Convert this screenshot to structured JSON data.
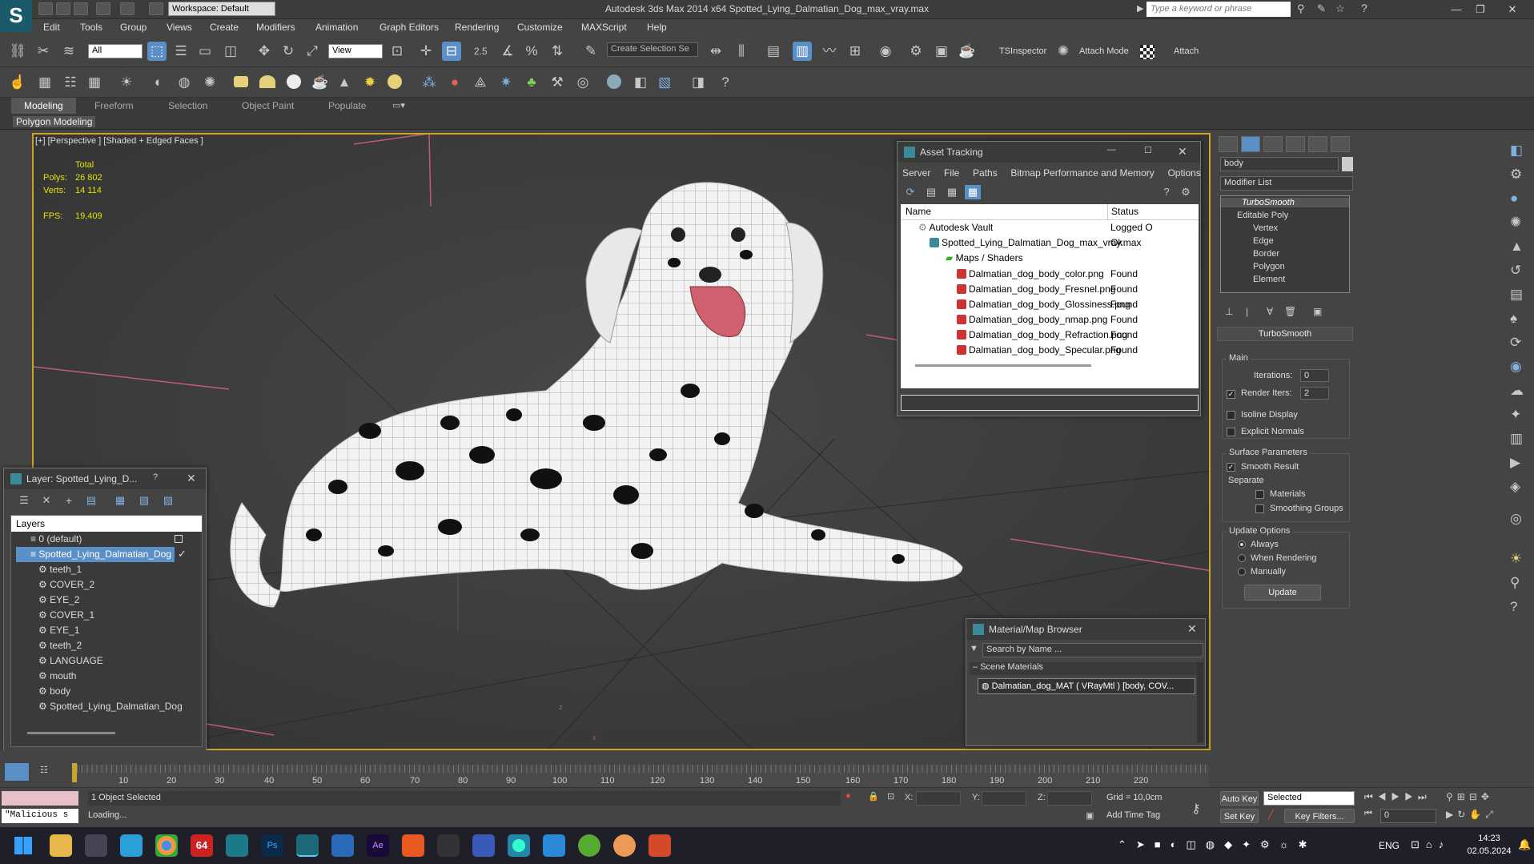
{
  "window": {
    "title": "Autodesk 3ds Max  2014 x64     Spotted_Lying_Dalmatian_Dog_max_vray.max",
    "workspace": "Workspace: Default",
    "search_placeholder": "Type a keyword or phrase"
  },
  "menu": [
    "Edit",
    "Tools",
    "Group",
    "Views",
    "Create",
    "Modifiers",
    "Animation",
    "Graph Editors",
    "Rendering",
    "Customize",
    "MAXScript",
    "Help"
  ],
  "toolbar": {
    "selection_filter": "All",
    "ref_coord": "View",
    "angle_snap": "2.5",
    "selection_set": "Create Selection Se",
    "tsinspector": "TSInspector",
    "attach_mode": "Attach Mode",
    "attach": "Attach"
  },
  "ribbon": {
    "tabs": [
      "Modeling",
      "Freeform",
      "Selection",
      "Object Paint",
      "Populate"
    ],
    "panel_label": "Polygon Modeling"
  },
  "viewport": {
    "label": "[+] [Perspective ] [Shaded + Edged Faces ]",
    "stats_header": "Total",
    "polys_label": "Polys:",
    "polys_value": "26 802",
    "verts_label": "Verts:",
    "verts_value": "14 114",
    "fps_label": "FPS:",
    "fps_value": "19,409",
    "axis_z": "z",
    "axis_x": "x"
  },
  "asset_tracking": {
    "title": "Asset Tracking",
    "menu": [
      "Server",
      "File",
      "Paths",
      "Bitmap Performance and Memory",
      "Options"
    ],
    "col_name": "Name",
    "col_status": "Status",
    "rows": [
      {
        "name": "Autodesk Vault",
        "status": "Logged O"
      },
      {
        "name": "Spotted_Lying_Dalmatian_Dog_max_vray.max",
        "status": "Ok"
      },
      {
        "name": "Maps / Shaders",
        "status": ""
      },
      {
        "name": "Dalmatian_dog_body_color.png",
        "status": "Found"
      },
      {
        "name": "Dalmatian_dog_body_Fresnel.png",
        "status": "Found"
      },
      {
        "name": "Dalmatian_dog_body_Glossiness.png",
        "status": "Found"
      },
      {
        "name": "Dalmatian_dog_body_nmap.png",
        "status": "Found"
      },
      {
        "name": "Dalmatian_dog_body_Refraction.png",
        "status": "Found"
      },
      {
        "name": "Dalmatian_dog_body_Specular.png",
        "status": "Found"
      }
    ]
  },
  "layer_explorer": {
    "title": "Layer: Spotted_Lying_D...",
    "help": "?",
    "header": "Layers",
    "layers": [
      "0 (default)",
      "Spotted_Lying_Dalmatian_Dog"
    ],
    "objects": [
      "teeth_1",
      "COVER_2",
      "EYE_2",
      "COVER_1",
      "EYE_1",
      "teeth_2",
      "LANGUAGE",
      "mouth",
      "body",
      "Spotted_Lying_Dalmatian_Dog"
    ]
  },
  "material_browser": {
    "title": "Material/Map Browser",
    "search_placeholder": "Search by Name ...",
    "section": "Scene Materials",
    "item": "Dalmatian_dog_MAT ( VRayMtl ) [body, COV..."
  },
  "command_panel": {
    "object_name": "body",
    "modifier_list": "Modifier List",
    "stack": [
      "TurboSmooth",
      "Editable Poly",
      "Vertex",
      "Edge",
      "Border",
      "Polygon",
      "Element"
    ],
    "rollout_title": "TurboSmooth",
    "main_label": "Main",
    "iterations_label": "Iterations:",
    "iterations_value": "0",
    "render_iters_label": "Render Iters:",
    "render_iters_value": "2",
    "isoline": "Isoline Display",
    "explicit_normals": "Explicit Normals",
    "surface_params": "Surface Parameters",
    "smooth_result": "Smooth Result",
    "separate": "Separate",
    "materials": "Materials",
    "smoothing_groups": "Smoothing Groups",
    "update_options": "Update Options",
    "always": "Always",
    "when_rendering": "When Rendering",
    "manually": "Manually",
    "update_button": "Update"
  },
  "timeline": {
    "ticks": [
      "10",
      "20",
      "30",
      "40",
      "50",
      "60",
      "70",
      "80",
      "90",
      "100",
      "110",
      "120",
      "130",
      "140",
      "150",
      "160",
      "170",
      "180",
      "190",
      "200",
      "210",
      "220"
    ]
  },
  "status": {
    "maxscript": "\"Malicious s",
    "selected": "1 Object Selected",
    "loading": "Loading...",
    "x_label": "X:",
    "y_label": "Y:",
    "z_label": "Z:",
    "grid": "Grid = 10,0cm",
    "add_time_tag": "Add Time Tag",
    "auto_key": "Auto Key",
    "set_key": "Set Key",
    "key_mode": "Selected",
    "key_filters": "Key Filters...",
    "frame": "0"
  },
  "taskbar": {
    "badge": "64",
    "lang": "ENG",
    "time": "14:23",
    "date": "02.05.2024"
  },
  "colors": {
    "accent": "#5b8fc7",
    "viewport_border": "#c8a52a",
    "stats": "#e6e000"
  }
}
